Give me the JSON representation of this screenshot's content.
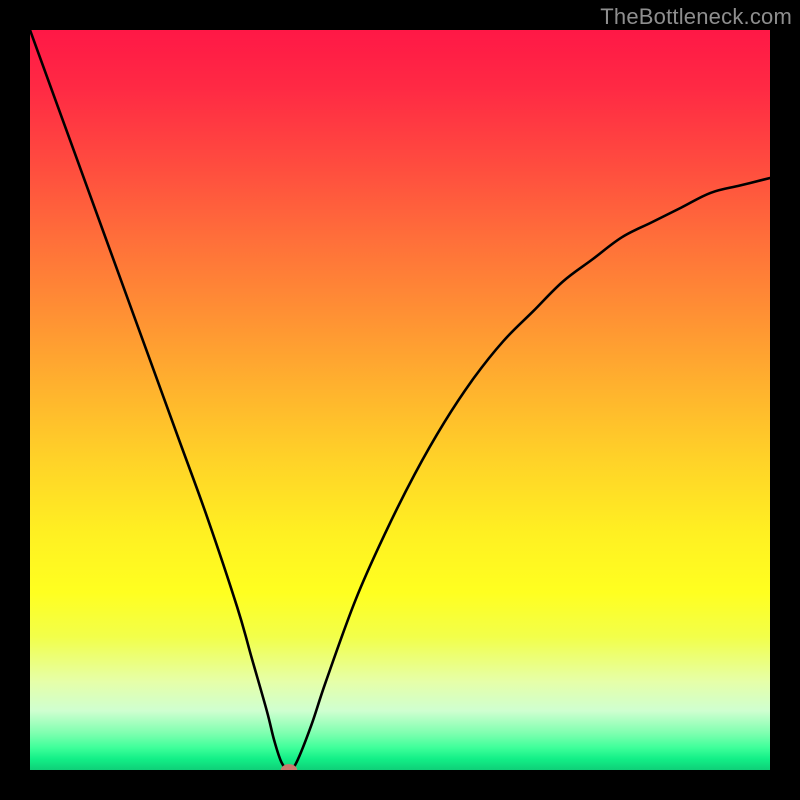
{
  "watermark": "TheBottleneck.com",
  "colors": {
    "frame": "#000000",
    "curve_stroke": "#000000",
    "marker_fill": "#c97a6e",
    "gradient_top": "#ff1846",
    "gradient_mid": "#ffff20",
    "gradient_bottom": "#0fcf78"
  },
  "chart_data": {
    "type": "line",
    "title": "",
    "xlabel": "",
    "ylabel": "",
    "xlim": [
      0,
      100
    ],
    "ylim": [
      0,
      100
    ],
    "x": [
      0,
      4,
      8,
      12,
      16,
      20,
      24,
      28,
      30,
      32,
      33,
      34,
      35,
      36,
      38,
      40,
      44,
      48,
      52,
      56,
      60,
      64,
      68,
      72,
      76,
      80,
      84,
      88,
      92,
      96,
      100
    ],
    "series": [
      {
        "name": "bottleneck-curve",
        "values": [
          100,
          89,
          78,
          67,
          56,
          45,
          34,
          22,
          15,
          8,
          4,
          1,
          0,
          1,
          6,
          12,
          23,
          32,
          40,
          47,
          53,
          58,
          62,
          66,
          69,
          72,
          74,
          76,
          78,
          79,
          80
        ]
      }
    ],
    "marker": {
      "x": 35,
      "y": 0,
      "rx": 1.1,
      "ry": 0.8
    },
    "grid": false,
    "legend": false
  }
}
